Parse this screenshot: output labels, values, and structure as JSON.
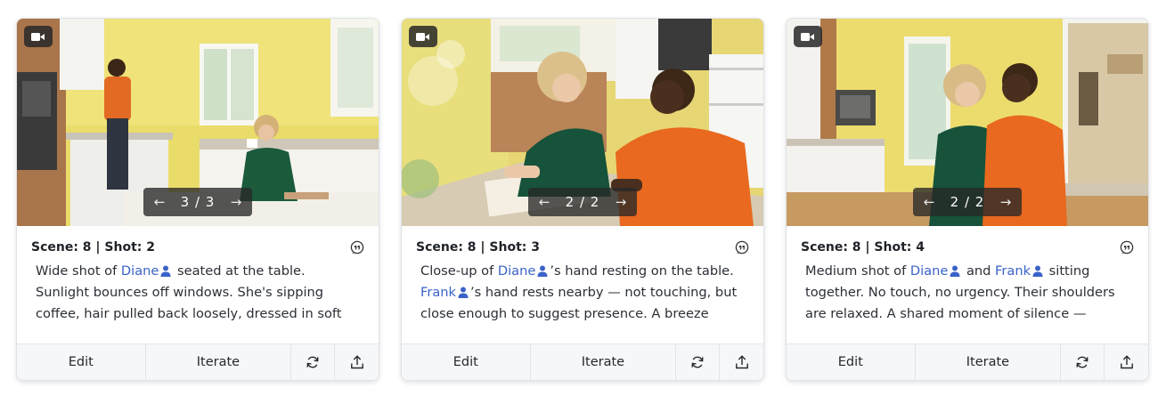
{
  "cards": [
    {
      "scene_label": "Scene: 8 | Shot: 2",
      "pager": {
        "prev": "←",
        "count": "3 / 3",
        "next": "→"
      },
      "desc": {
        "t0": "Wide shot of ",
        "p1": "Diane",
        "t1": " seated at the table. Sunlight bounces off windows. She's sipping coffee, hair pulled back loosely, dressed in soft colors. A..."
      },
      "actions": {
        "edit": "Edit",
        "iterate": "Iterate"
      }
    },
    {
      "scene_label": "Scene: 8 | Shot: 3",
      "pager": {
        "prev": "←",
        "count": "2 / 2",
        "next": "→"
      },
      "desc": {
        "t0": "Close-up of ",
        "p1": "Diane",
        "t1": "’s hand resting on the table. ",
        "p2": "Frank",
        "t2": "’s hand rests nearby — not touching, but close enough to suggest presence. A breeze flips..."
      },
      "actions": {
        "edit": "Edit",
        "iterate": "Iterate"
      }
    },
    {
      "scene_label": "Scene: 8 | Shot: 4",
      "pager": {
        "prev": "←",
        "count": "2 / 2",
        "next": "→"
      },
      "desc": {
        "t0": "Medium shot of ",
        "p1": "Diane",
        "t1": " and ",
        "p2": "Frank",
        "t2": " sitting together. No touch, no urgency. Their shoulders are relaxed. A shared moment of silence — they..."
      },
      "actions": {
        "edit": "Edit",
        "iterate": "Iterate"
      }
    }
  ],
  "icons": {
    "camera": "video-camera-icon",
    "quote": "quote-bubble-icon",
    "person": "person-icon",
    "refresh": "refresh-icon",
    "share": "share-upload-icon"
  },
  "colors": {
    "person_link": "#3a63c8",
    "pager_bg": "#282828",
    "footer_bg": "#f6f7f9"
  }
}
